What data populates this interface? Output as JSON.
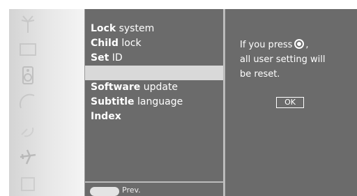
{
  "sidebar": {
    "icons": [
      "antenna-icon",
      "picture-icon",
      "speaker-icon",
      "clock-icon",
      "satellite-icon",
      "airplane-icon",
      "options-icon"
    ]
  },
  "menu": {
    "items": [
      {
        "first": "Lock",
        "rest": " system"
      },
      {
        "first": "Child",
        "rest": " lock"
      },
      {
        "first": "Set",
        "rest": " ID"
      },
      {
        "first": "",
        "rest": ""
      },
      {
        "first": "Software",
        "rest": " update"
      },
      {
        "first": "Subtitle",
        "rest": " language"
      },
      {
        "first": "Index",
        "rest": ""
      }
    ],
    "selected_index": 3,
    "footer": {
      "prev_label": "Prev."
    }
  },
  "dialog": {
    "line1_before": "If you press",
    "line1_after": ",",
    "line2": "all user setting will",
    "line3": "be reset.",
    "ok_label": "OK"
  },
  "colors": {
    "panel": "#6b6b6b",
    "selected_row": "#d9d9d9",
    "divider": "#bcbcbc",
    "text": "#ffffff"
  }
}
